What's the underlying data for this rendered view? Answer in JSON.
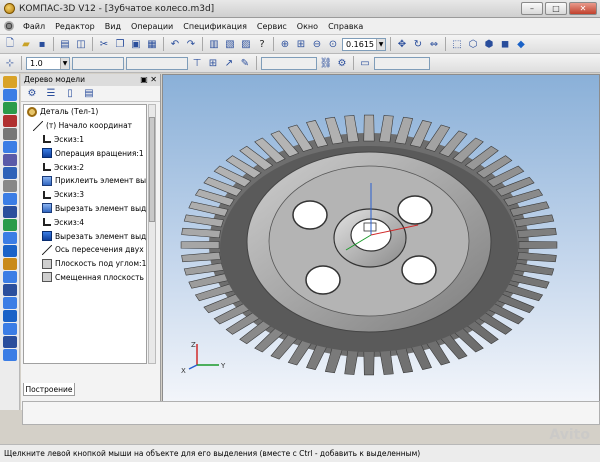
{
  "window": {
    "title": "КОМПАС-3D V12 - [Зубчатое колесо.m3d]",
    "minimize": "–",
    "maximize": "□",
    "close": "✕"
  },
  "menu": [
    "Файл",
    "Редактор",
    "Вид",
    "Операции",
    "Спецификация",
    "Сервис",
    "Окно",
    "Справка"
  ],
  "toolbar": {
    "zoom_value": "0.1615",
    "scale_value": "1.0"
  },
  "model_tree": {
    "header": "Дерево модели",
    "header_buttons": "▣ ✕",
    "items": [
      {
        "label": "Деталь (Тел-1)",
        "icon": "part-icon"
      },
      {
        "label": "(т) Начало координат",
        "icon": "axis-icon"
      },
      {
        "label": "Эскиз:1",
        "icon": "sketch-icon"
      },
      {
        "label": "Операция вращения:1",
        "icon": "operation-icon"
      },
      {
        "label": "Эскиз:2",
        "icon": "sketch-icon"
      },
      {
        "label": "Приклеить элемент выдавливания",
        "icon": "operation-icon"
      },
      {
        "label": "Эскиз:3",
        "icon": "sketch-icon"
      },
      {
        "label": "Вырезать элемент выдавливания",
        "icon": "operation-icon"
      },
      {
        "label": "Эскиз:4",
        "icon": "sketch-icon"
      },
      {
        "label": "Вырезать элемент выдавливания",
        "icon": "operation-icon"
      },
      {
        "label": "Ось пересечения двух плоскостей",
        "icon": "axis-icon"
      },
      {
        "label": "Плоскость под углом:1",
        "icon": "plane-icon"
      },
      {
        "label": "Смещенная плоскость",
        "icon": "plane-icon"
      }
    ],
    "tab": "Построение"
  },
  "viewport": {
    "axis_x": "X",
    "axis_y": "Y",
    "axis_z": "Z"
  },
  "status": "Щелкните левой кнопкой мыши на объекте для его выделения (вместе с Ctrl - добавить к выделенным)",
  "watermark": "Avito"
}
